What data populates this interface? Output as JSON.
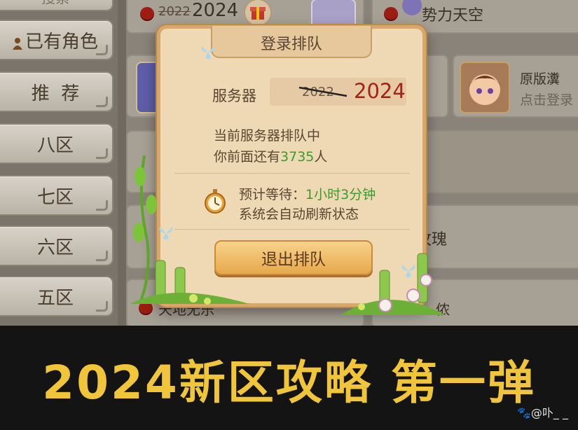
{
  "sidebar": {
    "top_partial": "搜索",
    "items": [
      {
        "label": "已有角色"
      },
      {
        "label": "推  荐"
      },
      {
        "label": "八区"
      },
      {
        "label": "七区"
      },
      {
        "label": "六区"
      },
      {
        "label": "五区"
      }
    ]
  },
  "server_list": {
    "top_left": {
      "old_year": "2022",
      "new_year": "2024"
    },
    "top_right": {
      "name": "势力天空"
    },
    "right_card": {
      "name": "原版瀵",
      "action": "点击登录"
    },
    "partial_right_1": "玫瑰",
    "partial_right_2": "侬",
    "partial_left_bottom": "天地无乐"
  },
  "dialog": {
    "title": "登录排队",
    "server_label": "服务器",
    "server_old": "2022",
    "server_new": "2024",
    "queue_status": "当前服务器排队中",
    "ahead_prefix": "你前面还有",
    "ahead_count": "3735",
    "ahead_suffix": "人",
    "wait_label": "预计等待：",
    "wait_value": "1小时3分钟",
    "auto_refresh": "系统会自动刷新状态",
    "exit_button": "退出排队"
  },
  "banner": {
    "title": "2024新区攻略 第一弹",
    "watermark": "🐾@卟_  _"
  },
  "colors": {
    "banner_title": "#f0c53a",
    "green_text": "#3a9b2a",
    "red_year": "#a3231a"
  }
}
